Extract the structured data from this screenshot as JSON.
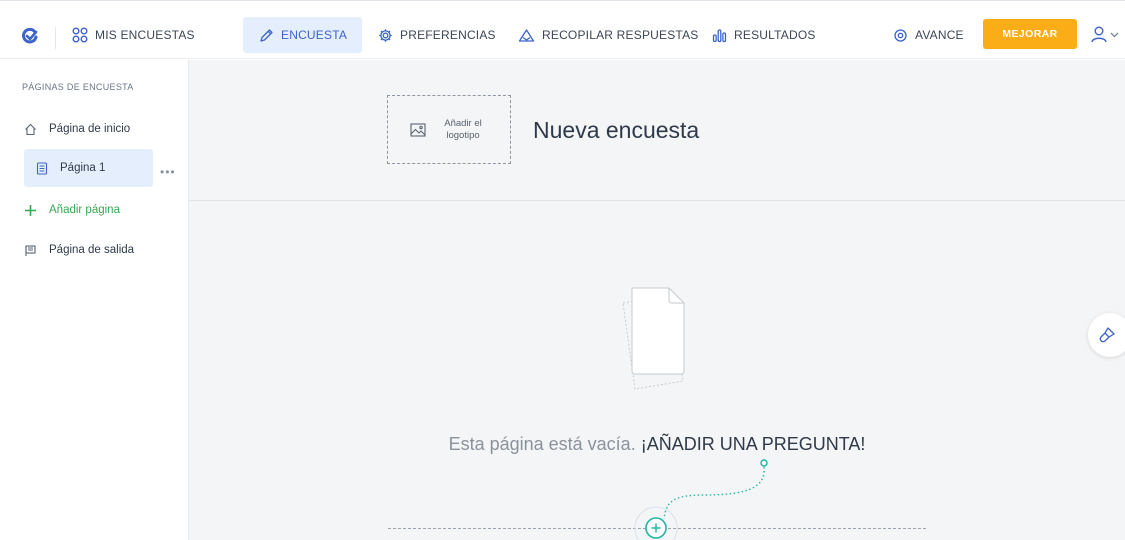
{
  "topbar": {
    "my_surveys": "MIS ENCUESTAS",
    "tabs": [
      {
        "label": "ENCUESTA",
        "icon": "pencil-icon",
        "active": true
      },
      {
        "label": "PREFERENCIAS",
        "icon": "gear-icon",
        "active": false
      },
      {
        "label": "RECOPILAR RESPUESTAS",
        "icon": "send-icon",
        "active": false
      },
      {
        "label": "RESULTADOS",
        "icon": "bar-chart-icon",
        "active": false
      }
    ],
    "preview": "AVANCE",
    "upgrade": "MEJORAR"
  },
  "sidebar": {
    "heading": "PÁGINAS DE ENCUESTA",
    "items": [
      {
        "label": "Página de inicio",
        "icon": "home-icon"
      },
      {
        "label": "Página 1",
        "icon": "page-icon",
        "active": true
      },
      {
        "label": "Añadir página",
        "icon": "plus-icon"
      },
      {
        "label": "Página de salida",
        "icon": "flag-icon"
      }
    ],
    "more": "•••"
  },
  "main": {
    "logo_placeholder": "Añadir el logotipo",
    "title": "Nueva encuesta",
    "empty_text": "Esta página está vacía.",
    "add_question": "¡AÑADIR UNA PREGUNTA!"
  },
  "colors": {
    "accent": "#3d63c9",
    "active_bg": "#e5eefc",
    "upgrade": "#fbad18",
    "teal": "#1fb5a6",
    "green": "#34a853"
  }
}
